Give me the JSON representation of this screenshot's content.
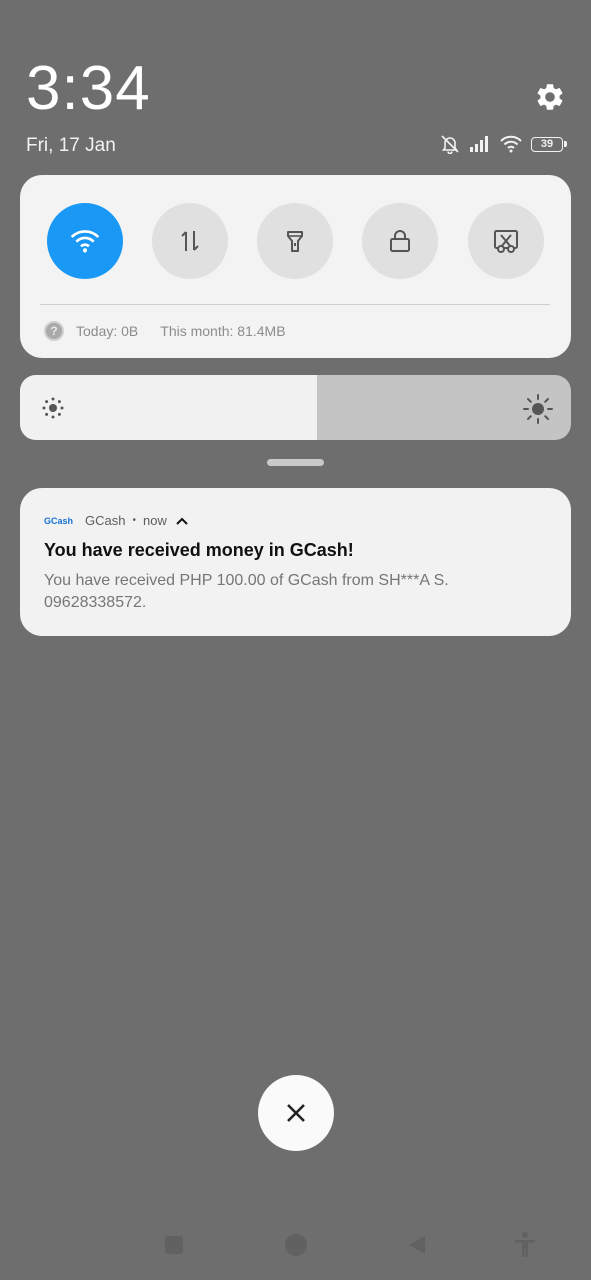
{
  "status": {
    "time": "3:34",
    "date": "Fri, 17 Jan",
    "battery_level": "39",
    "icons": [
      "dnd-bell-off-icon",
      "signal-icon",
      "wifi-icon",
      "battery-icon"
    ]
  },
  "quick_settings": {
    "tiles": [
      {
        "name": "Wi-Fi",
        "icon": "wifi-icon",
        "active": true
      },
      {
        "name": "Mobile data",
        "icon": "data-arrows-icon",
        "active": false
      },
      {
        "name": "Flashlight",
        "icon": "flashlight-icon",
        "active": false
      },
      {
        "name": "Lock screen",
        "icon": "lock-icon",
        "active": false
      },
      {
        "name": "Screenshot",
        "icon": "screenshot-icon",
        "active": false
      }
    ],
    "data_today": "Today: 0B",
    "data_month": "This month: 81.4MB"
  },
  "brightness": {
    "level_percent": 54
  },
  "notification": {
    "app_logo": "GCash",
    "app_name": "GCash",
    "time": "now",
    "title": "You have received money in GCash!",
    "body": "You have received PHP 100.00 of GCash from SH***A S. 09628338572."
  },
  "colors": {
    "accent": "#1a98f5",
    "background": "#6e6e6e",
    "panel": "#f3f3f3"
  }
}
